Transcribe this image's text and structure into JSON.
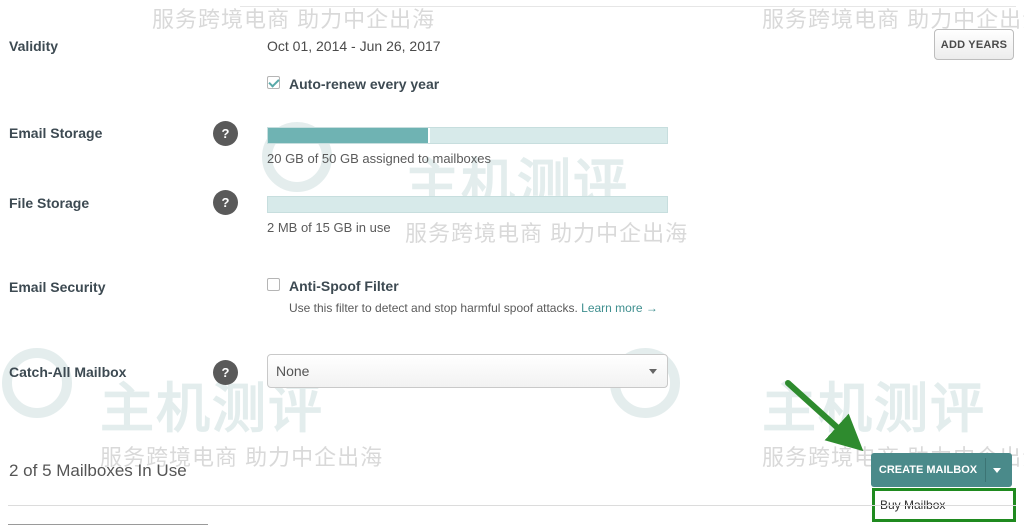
{
  "validity": {
    "label": "Validity",
    "dates": "Oct 01, 2014 - Jun 26, 2017",
    "add_years_button": "ADD YEARS",
    "auto_renew_label": "Auto-renew every year",
    "auto_renew_checked": true
  },
  "email_storage": {
    "label": "Email Storage",
    "help": "?",
    "used_fraction": 0.4,
    "caption": "20 GB of 50 GB assigned to mailboxes"
  },
  "file_storage": {
    "label": "File Storage",
    "help": "?",
    "used_fraction": 0.0,
    "caption": "2 MB of 15 GB in use"
  },
  "email_security": {
    "label": "Email Security",
    "filter_label": "Anti-Spoof Filter",
    "filter_checked": false,
    "description": "Use this filter to detect and stop harmful spoof attacks.",
    "learn_more": "Learn more →"
  },
  "catch_all": {
    "label": "Catch-All Mailbox",
    "help": "?",
    "selected": "None"
  },
  "mailboxes": {
    "count_text": "2 of 5 Mailboxes In Use",
    "create_button": "CREATE MAILBOX",
    "dropdown_item": "Buy Mailbox"
  },
  "watermark": {
    "caption": "服务跨境电商 助力中企出海",
    "brand": "主机测评"
  },
  "colors": {
    "accent": "#4a8a8a",
    "bar_fill": "#6fb3b3",
    "highlight": "#1f8a1f"
  }
}
